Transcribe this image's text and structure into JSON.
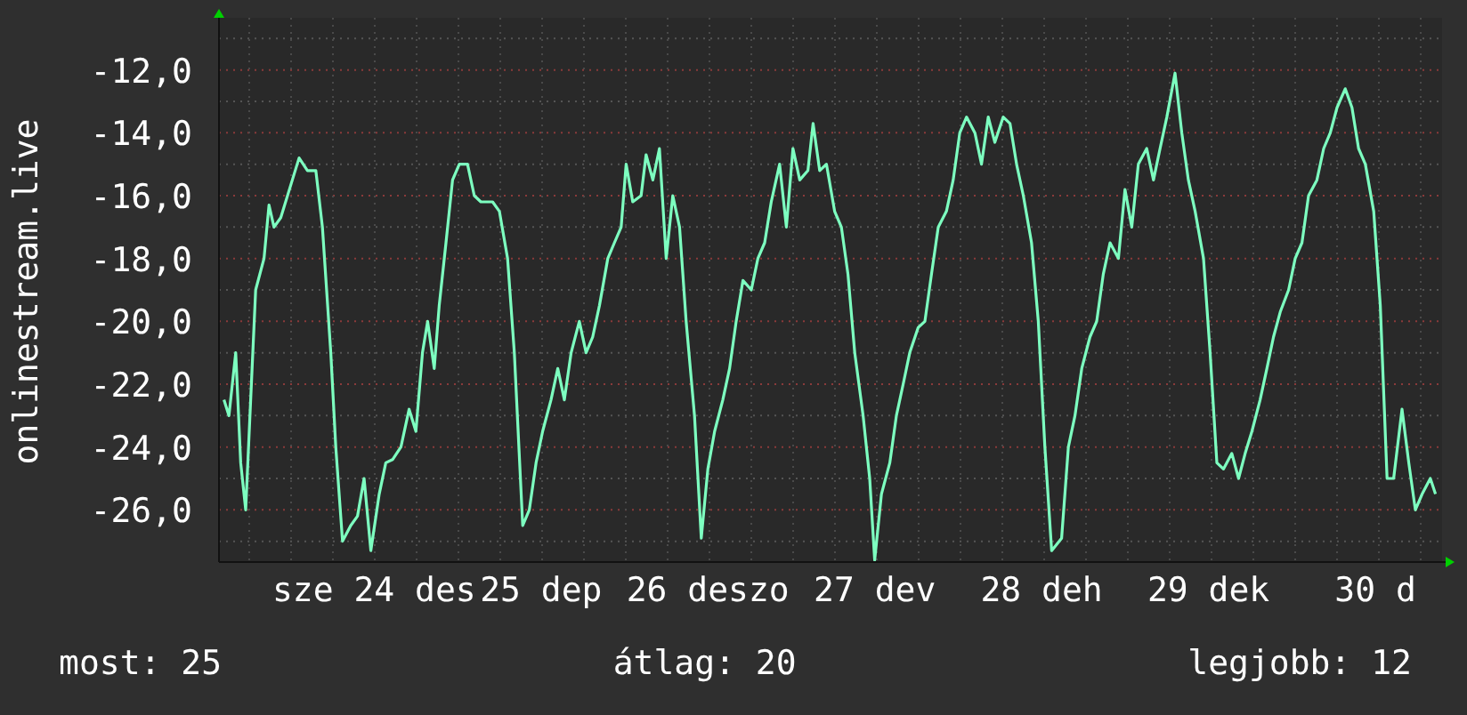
{
  "chart": {
    "chart_data": {
      "type": "line",
      "ylabel": "onlinestream.live",
      "grid": true,
      "x": [
        23.1,
        23.13,
        23.17,
        23.2,
        23.23,
        23.26,
        23.29,
        23.34,
        23.37,
        23.4,
        23.44,
        23.51,
        23.55,
        23.6,
        23.65,
        23.69,
        23.74,
        23.77,
        23.81,
        23.86,
        23.9,
        23.94,
        23.98,
        24.03,
        24.07,
        24.11,
        24.16,
        24.21,
        24.25,
        24.29,
        24.32,
        24.36,
        24.39,
        24.43,
        24.47,
        24.51,
        24.56,
        24.6,
        24.64,
        24.71,
        24.75,
        24.8,
        24.84,
        24.89,
        24.93,
        24.97,
        25.01,
        25.06,
        25.1,
        25.14,
        25.18,
        25.23,
        25.27,
        25.31,
        25.35,
        25.4,
        25.44,
        25.48,
        25.51,
        25.55,
        25.6,
        25.63,
        25.67,
        25.71,
        25.75,
        25.79,
        25.83,
        25.87,
        25.92,
        25.96,
        26,
        26.04,
        26.09,
        26.13,
        26.17,
        26.21,
        26.26,
        26.3,
        26.34,
        26.38,
        26.43,
        26.47,
        26.51,
        26.55,
        26.6,
        26.63,
        26.67,
        26.71,
        26.76,
        26.8,
        26.84,
        26.88,
        26.93,
        26.97,
        27,
        27.04,
        27.09,
        27.13,
        27.17,
        27.21,
        27.26,
        27.3,
        27.34,
        27.38,
        27.43,
        27.47,
        27.51,
        27.55,
        27.6,
        27.64,
        27.68,
        27.72,
        27.77,
        27.81,
        27.85,
        27.89,
        27.94,
        27.98,
        28.02,
        28.06,
        28.12,
        28.16,
        28.2,
        28.24,
        28.29,
        28.33,
        28.37,
        28.41,
        28.46,
        28.5,
        28.54,
        28.58,
        28.63,
        28.67,
        28.71,
        28.75,
        28.8,
        28.84,
        28.88,
        28.92,
        28.97,
        29.01,
        29.05,
        29.09,
        29.14,
        29.18,
        29.22,
        29.26,
        29.31,
        29.35,
        29.39,
        29.43,
        29.48,
        29.52,
        29.56,
        29.6,
        29.65,
        29.69,
        29.73,
        29.77,
        29.82,
        29.86,
        29.9,
        29.94,
        29.99,
        30.03,
        30.07,
        30.11,
        30.16,
        30.2,
        30.24,
        30.28,
        30.33,
        30.36
      ],
      "ylim": [
        -27.66,
        -10.34
      ],
      "xlim": [
        23.07,
        30.4
      ],
      "yticks": [
        {
          "value": -12,
          "label": "-12,0"
        },
        {
          "value": -14,
          "label": "-14,0"
        },
        {
          "value": -16,
          "label": "-16,0"
        },
        {
          "value": -18,
          "label": "-18,0"
        },
        {
          "value": -20,
          "label": "-20,0"
        },
        {
          "value": -22,
          "label": "-22,0"
        },
        {
          "value": -24,
          "label": "-24,0"
        },
        {
          "value": -26,
          "label": "-26,0"
        }
      ],
      "xticks": [
        {
          "value": 24,
          "label": "sze 24 des"
        },
        {
          "value": 25,
          "label": "25 dep"
        },
        {
          "value": 26,
          "label": "26 deszo"
        },
        {
          "value": 27,
          "label": "27 dev"
        },
        {
          "value": 28,
          "label": "28 deh"
        },
        {
          "value": 29,
          "label": "29 dek"
        },
        {
          "value": 30,
          "label": "30 d"
        }
      ],
      "series": [
        {
          "color": "#7dffc0",
          "values": [
            -22.5,
            -23,
            -21,
            -24.5,
            -26,
            -22.5,
            -19,
            -18,
            -16.3,
            -17,
            -16.7,
            -15.5,
            -14.8,
            -15.2,
            -15.2,
            -17,
            -21,
            -24,
            -27,
            -26.5,
            -26.2,
            -25,
            -27.3,
            -25.5,
            -24.5,
            -24.4,
            -24,
            -22.8,
            -23.5,
            -21,
            -20,
            -21.5,
            -19.5,
            -17.5,
            -15.5,
            -15,
            -15,
            -16,
            -16.2,
            -16.2,
            -16.5,
            -18,
            -21,
            -26.5,
            -26,
            -24.5,
            -23.5,
            -22.5,
            -21.5,
            -22.5,
            -21,
            -20,
            -21,
            -20.5,
            -19.5,
            -18,
            -17.5,
            -17,
            -15,
            -16.2,
            -16,
            -14.7,
            -15.5,
            -14.5,
            -18,
            -16,
            -17,
            -20,
            -23,
            -26.9,
            -24.7,
            -23.5,
            -22.5,
            -21.5,
            -20,
            -18.7,
            -19,
            -18,
            -17.5,
            -16.2,
            -15,
            -17,
            -14.5,
            -15.5,
            -15.2,
            -13.7,
            -15.2,
            -15,
            -16.5,
            -17,
            -18.5,
            -21,
            -23,
            -25,
            -27.6,
            -25.5,
            -24.5,
            -23,
            -22,
            -21,
            -20.2,
            -20,
            -18.5,
            -17,
            -16.5,
            -15.5,
            -14,
            -13.5,
            -14,
            -15,
            -13.5,
            -14.3,
            -13.5,
            -13.7,
            -15,
            -16,
            -17.5,
            -20,
            -24,
            -27.3,
            -26.9,
            -24,
            -23,
            -21.5,
            -20.5,
            -20,
            -18.5,
            -17.5,
            -18,
            -15.8,
            -17,
            -15,
            -14.5,
            -15.5,
            -14.5,
            -13.5,
            -12.1,
            -14,
            -15.5,
            -16.5,
            -18,
            -21,
            -24.5,
            -24.7,
            -24.2,
            -25,
            -24.2,
            -23.5,
            -22.5,
            -21.5,
            -20.5,
            -19.7,
            -19,
            -18,
            -17.5,
            -16,
            -15.5,
            -14.5,
            -14,
            -13.2,
            -12.6,
            -13.2,
            -14.5,
            -15,
            -16.5,
            -19.5,
            -25,
            -25,
            -22.8,
            -24.5,
            -26,
            -25.5,
            -25,
            -25.5
          ]
        }
      ]
    }
  },
  "legend": [
    "most: 25",
    "átlag: 20",
    "legjobb: 12"
  ]
}
